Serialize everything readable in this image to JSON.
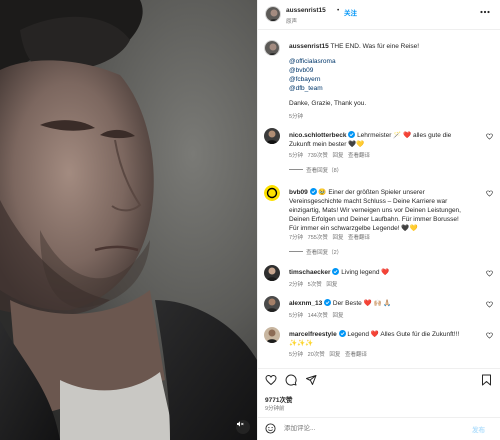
{
  "header": {
    "username": "aussenrist15",
    "separator": "•",
    "follow_label": "关注",
    "subtitle": "原声"
  },
  "caption": {
    "username": "aussenrist15",
    "text": "THE END. Was für eine Reise!",
    "mentions": [
      "@officialasroma",
      "@bvb09",
      "@fcbayern",
      "@dfb_team"
    ],
    "thanks": "Danke, Grazie, Thank you.",
    "time": "5分钟"
  },
  "comments": [
    {
      "username": "nico.schlotterbeck",
      "text": "Lehrmeister 🪄 ❤️ alles gute die Zukunft mein bester 🖤💛",
      "time": "5分钟",
      "likes": "739次赞",
      "reply": "回复",
      "translate": "查看翻译",
      "view_replies": "查看回复（8）"
    },
    {
      "username": "bvb09",
      "text": "🥹 Einer der größten Spieler unserer Vereinsgeschichte macht Schluss – Deine Karriere war einzigartig, Mats! Wir verneigen uns vor Deinen Leistungen, Deinen Erfolgen und Deiner Laufbahn. Für immer Borusse! Für immer ein schwarzgelbe Legende! 🖤💛",
      "time": "7分钟",
      "likes": "755次赞",
      "reply": "回复",
      "translate": "查看翻译",
      "view_replies": "查看回复（2）"
    },
    {
      "username": "timschaecker",
      "text": "Living legend ❤️",
      "time": "2分钟",
      "likes": "5次赞",
      "reply": "回复"
    },
    {
      "username": "alexnm_13",
      "text": "Der Beste ❤️ 🙌🏼 🙏🏼",
      "time": "5分钟",
      "likes": "144次赞",
      "reply": "回复"
    },
    {
      "username": "marcelfreestyle",
      "text": "Legend ❤️ Alles Gute für die Zukunft!!! ✨✨✨",
      "time": "5分钟",
      "likes": "20次赞",
      "reply": "回复",
      "translate": "查看翻译"
    }
  ],
  "stats": {
    "likes": "9771次赞",
    "time": "9分钟前"
  },
  "composer": {
    "placeholder": "添加评论...",
    "post_label": "发布"
  },
  "colors": {
    "link": "#00376b",
    "accent": "#0095f6",
    "heart": "#ed4956",
    "muted": "#737373"
  }
}
